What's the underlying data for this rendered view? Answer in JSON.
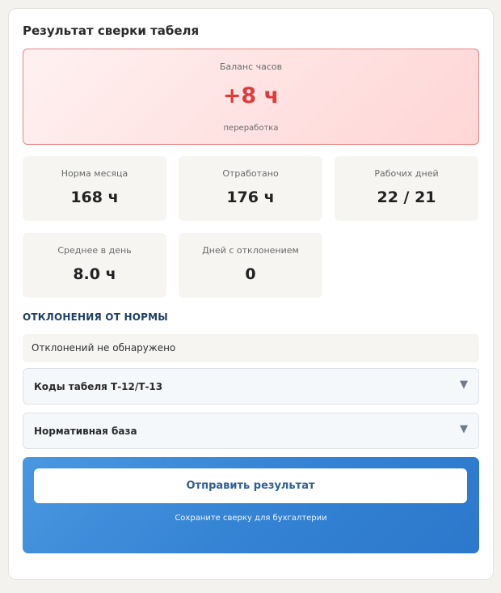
{
  "header": {
    "title": "Результат сверки табеля"
  },
  "balance": {
    "label": "Баланс часов",
    "value": "+8 ч",
    "note": "переработка",
    "color": "#e03b3b"
  },
  "stats": [
    {
      "label": "Норма месяца",
      "value": "168 ч"
    },
    {
      "label": "Отработано",
      "value": "176 ч"
    },
    {
      "label": "Рабочих дней",
      "value": "22 / 21"
    },
    {
      "label": "Среднее в день",
      "value": "8.0 ч"
    },
    {
      "label": "Дней с отклонением",
      "value": "0"
    }
  ],
  "deviations": {
    "heading": "ОТКЛОНЕНИЯ ОТ НОРМЫ",
    "empty_text": "Отклонений не обнаружено"
  },
  "accordions": [
    {
      "label": "Коды табеля Т-12/Т-13",
      "icon": "chevron-down-icon",
      "glyph": "▼"
    },
    {
      "label": "Нормативная база",
      "icon": "chevron-down-icon",
      "glyph": "▼"
    }
  ],
  "submit": {
    "button_label": "Отправить результат",
    "hint": "Сохраните сверку для бухгалтерии",
    "accent": "#3382d3"
  }
}
